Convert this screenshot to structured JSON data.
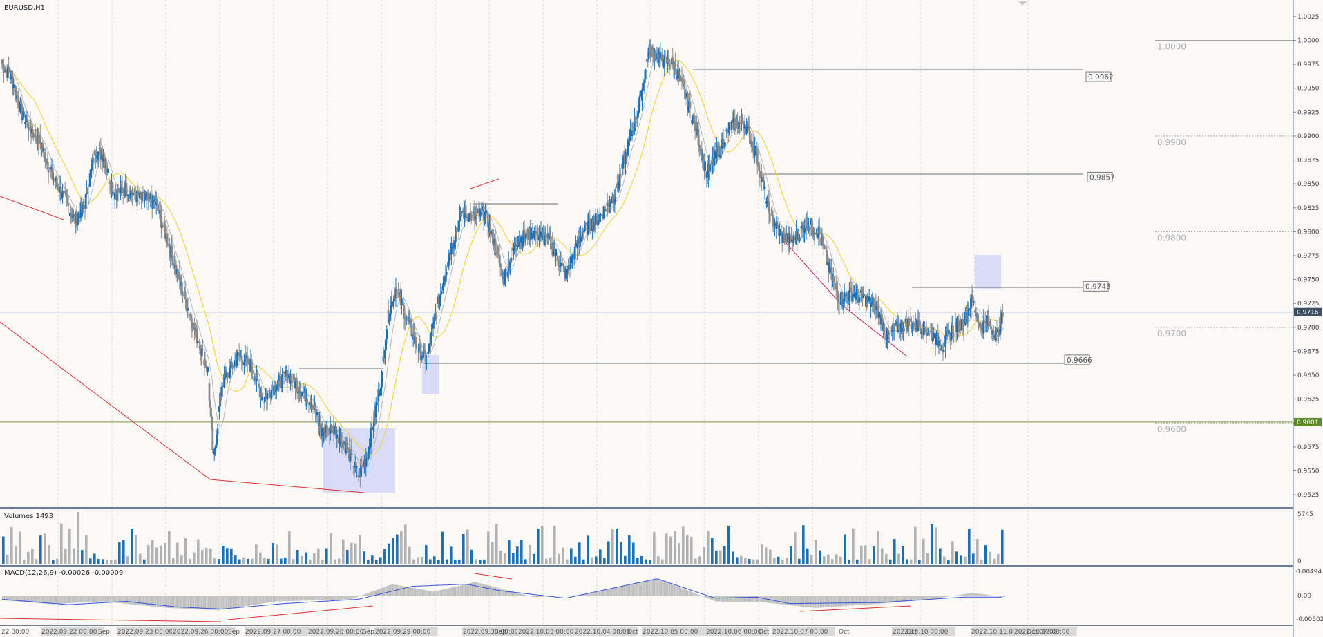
{
  "window": {
    "title": "EURUSD,H1"
  },
  "colors": {
    "background": "#fbf9f8",
    "bull_candle": "#1f6fb3",
    "bear_candle": "#8a8a8a",
    "ma_slow": "#f3d44a",
    "ma_fast": "#b9b9b9",
    "trendline": "#e02f2f",
    "volume_bull": "#1f6fb3",
    "volume_bear": "#b2b2b2",
    "macd_hist": "#c0c0c0",
    "macd_signal": "#3354d6",
    "zone": "#d2d7f6",
    "current_price_tag": "#3d4f63",
    "level_0_96_tag": "#5d8a2a",
    "separator": "#6d7f96"
  },
  "main_panel": {
    "price_axis": {
      "min": 0.9515,
      "max": 1.0035,
      "ticks": [
        "1.0025",
        "1.0000",
        "0.9975",
        "0.9950",
        "0.9925",
        "0.9900",
        "0.9875",
        "0.9850",
        "0.9825",
        "0.9800",
        "0.9775",
        "0.9750",
        "0.9725",
        "0.9700",
        "0.9675",
        "0.9650",
        "0.9625",
        "0.9600",
        "0.9575",
        "0.9550",
        "0.9525"
      ]
    },
    "current_price": "0.9716",
    "green_level": "0.9601",
    "level_labels": [
      {
        "text": "0.9962",
        "value": 0.9962
      },
      {
        "text": "0.9857",
        "value": 0.9857
      },
      {
        "text": "0.9743",
        "value": 0.9743
      },
      {
        "text": "0.9666",
        "value": 0.9666
      }
    ],
    "round_levels": [
      {
        "text": "1.0000",
        "value": 1.0
      },
      {
        "text": "0.9900",
        "value": 0.99
      },
      {
        "text": "0.9800",
        "value": 0.98
      },
      {
        "text": "0.9700",
        "value": 0.97
      },
      {
        "text": "0.9600",
        "value": 0.96
      }
    ]
  },
  "volume_panel": {
    "label": "Volumes 1493",
    "axis_top": "5745",
    "axis_bottom": "0"
  },
  "macd_panel": {
    "label": "MACD(12,26,9) -0.00026 -0.00009",
    "axis_top": "0.00494",
    "axis_mid": "0.00",
    "axis_bottom": "-0.00502"
  },
  "time_axis": {
    "labels": [
      "22 00:00",
      "2022.09.22 00:00",
      "Sep",
      "2022.09.23 00:00",
      "2022.09.26 00:00",
      "Sep",
      "2022.09.27 00:00",
      "2022.09.28 00:00",
      "Sep",
      "2022.09.29 00:00",
      "2022.09.30 00:00",
      "Sep",
      "2022.10.03 00:00",
      "2022.10.04 00:00",
      "Oct",
      "2022.10.05 00:00",
      "2022.10.06 00:00",
      "Oct",
      "2022.10.07 00:00",
      "Oct",
      "2022.10.10 00:00",
      "Oct",
      "2022.10.11 00:00",
      "2022.10.12 00:00",
      "Oct 07:00"
    ]
  },
  "chart_data": {
    "type": "candlestick",
    "symbol": "EURUSD",
    "timeframe": "H1",
    "ylim": [
      0.9515,
      1.0035
    ],
    "anchors": [
      [
        0,
        0.9975
      ],
      [
        12,
        0.996
      ],
      [
        25,
        0.992
      ],
      [
        45,
        0.9895
      ],
      [
        60,
        0.986
      ],
      [
        75,
        0.9835
      ],
      [
        88,
        0.9812
      ],
      [
        100,
        0.983
      ],
      [
        112,
        0.9885
      ],
      [
        122,
        0.988
      ],
      [
        135,
        0.984
      ],
      [
        150,
        0.9845
      ],
      [
        165,
        0.9835
      ],
      [
        185,
        0.983
      ],
      [
        200,
        0.979
      ],
      [
        215,
        0.9745
      ],
      [
        235,
        0.969
      ],
      [
        248,
        0.9655
      ],
      [
        255,
        0.956
      ],
      [
        265,
        0.964
      ],
      [
        285,
        0.967
      ],
      [
        300,
        0.966
      ],
      [
        315,
        0.9625
      ],
      [
        330,
        0.964
      ],
      [
        345,
        0.965
      ],
      [
        360,
        0.9635
      ],
      [
        375,
        0.962
      ],
      [
        385,
        0.959
      ],
      [
        400,
        0.9595
      ],
      [
        415,
        0.9575
      ],
      [
        430,
        0.9545
      ],
      [
        440,
        0.9565
      ],
      [
        450,
        0.961
      ],
      [
        458,
        0.965
      ],
      [
        465,
        0.971
      ],
      [
        475,
        0.974
      ],
      [
        488,
        0.971
      ],
      [
        500,
        0.968
      ],
      [
        512,
        0.9665
      ],
      [
        525,
        0.972
      ],
      [
        540,
        0.978
      ],
      [
        555,
        0.982
      ],
      [
        570,
        0.9815
      ],
      [
        582,
        0.982
      ],
      [
        595,
        0.9785
      ],
      [
        605,
        0.975
      ],
      [
        620,
        0.979
      ],
      [
        640,
        0.98
      ],
      [
        660,
        0.979
      ],
      [
        680,
        0.9755
      ],
      [
        700,
        0.98
      ],
      [
        720,
        0.9815
      ],
      [
        740,
        0.984
      ],
      [
        755,
        0.989
      ],
      [
        768,
        0.993
      ],
      [
        780,
        0.999
      ],
      [
        795,
        0.998
      ],
      [
        810,
        0.9975
      ],
      [
        825,
        0.994
      ],
      [
        838,
        0.9905
      ],
      [
        850,
        0.986
      ],
      [
        862,
        0.988
      ],
      [
        878,
        0.991
      ],
      [
        895,
        0.9915
      ],
      [
        910,
        0.988
      ],
      [
        925,
        0.982
      ],
      [
        940,
        0.9795
      ],
      [
        955,
        0.979
      ],
      [
        970,
        0.981
      ],
      [
        985,
        0.98
      ],
      [
        998,
        0.976
      ],
      [
        1010,
        0.973
      ],
      [
        1025,
        0.9735
      ],
      [
        1040,
        0.973
      ],
      [
        1055,
        0.972
      ],
      [
        1068,
        0.969
      ],
      [
        1080,
        0.97
      ],
      [
        1095,
        0.9705
      ],
      [
        1110,
        0.97
      ],
      [
        1125,
        0.969
      ],
      [
        1135,
        0.968
      ],
      [
        1148,
        0.97
      ],
      [
        1160,
        0.9705
      ],
      [
        1170,
        0.973
      ],
      [
        1180,
        0.97
      ],
      [
        1190,
        0.9705
      ],
      [
        1200,
        0.969
      ],
      [
        1208,
        0.9716
      ]
    ],
    "volume_range": [
      0,
      5745
    ],
    "macd_range": [
      -0.00502,
      0.00494
    ],
    "macd_hist_anchors": [
      [
        0,
        -0.0008
      ],
      [
        60,
        -0.0015
      ],
      [
        120,
        -0.001
      ],
      [
        200,
        -0.0022
      ],
      [
        260,
        -0.0026
      ],
      [
        330,
        -0.001
      ],
      [
        420,
        -0.0006
      ],
      [
        470,
        0.0022
      ],
      [
        520,
        0.0008
      ],
      [
        570,
        0.0026
      ],
      [
        640,
        -0.0002
      ],
      [
        700,
        0.0002
      ],
      [
        790,
        0.0032
      ],
      [
        860,
        -0.001
      ],
      [
        920,
        -0.0012
      ],
      [
        980,
        -0.0022
      ],
      [
        1060,
        -0.0014
      ],
      [
        1120,
        -0.0006
      ],
      [
        1170,
        0.0006
      ],
      [
        1208,
        -0.0002
      ]
    ],
    "macd_signal_anchors": [
      [
        0,
        -0.0006
      ],
      [
        80,
        -0.0016
      ],
      [
        150,
        -0.001
      ],
      [
        210,
        -0.002
      ],
      [
        265,
        -0.0024
      ],
      [
        340,
        -0.0014
      ],
      [
        430,
        -0.0006
      ],
      [
        495,
        0.0018
      ],
      [
        560,
        0.0022
      ],
      [
        600,
        0.001
      ],
      [
        680,
        -0.0004
      ],
      [
        790,
        0.0032
      ],
      [
        860,
        -0.0004
      ],
      [
        910,
        -0.0002
      ],
      [
        950,
        -0.0014
      ],
      [
        1060,
        -0.0012
      ],
      [
        1160,
        -0.0002
      ],
      [
        1208,
        -0.0002
      ]
    ]
  }
}
